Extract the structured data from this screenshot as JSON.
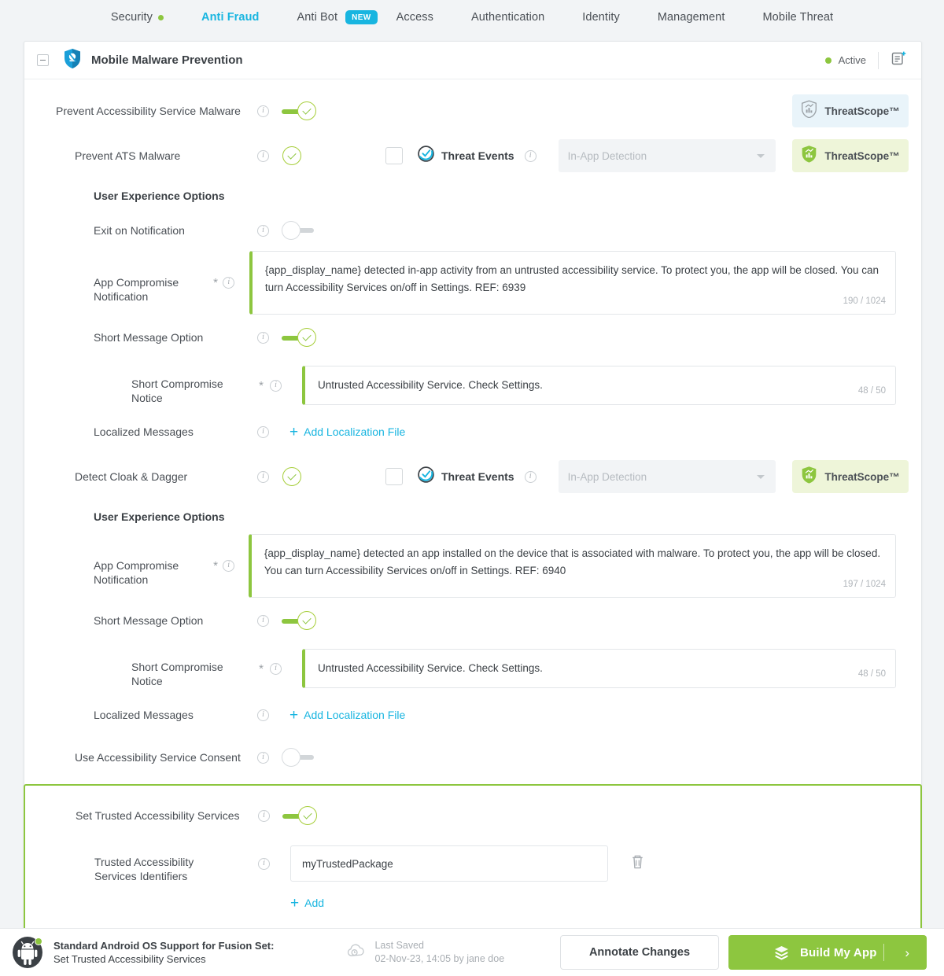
{
  "topnav": {
    "items": [
      {
        "label": "Security",
        "dot": true,
        "active": false
      },
      {
        "label": "Anti Fraud",
        "dot": false,
        "active": true
      },
      {
        "label": "Anti Bot",
        "dot": false,
        "active": false,
        "badge": "NEW"
      },
      {
        "label": "Access",
        "dot": false,
        "active": false
      },
      {
        "label": "Authentication",
        "dot": false,
        "active": false
      },
      {
        "label": "Identity",
        "dot": false,
        "active": false
      },
      {
        "label": "Management",
        "dot": false,
        "active": false
      },
      {
        "label": "Mobile Threat",
        "dot": false,
        "active": false
      }
    ]
  },
  "card": {
    "title": "Mobile Malware Prevention",
    "status": "Active",
    "icons": {
      "collapse": "collapse-minus-icon",
      "shield": "shield-malware-icon",
      "notes": "add-note-icon"
    }
  },
  "rows": {
    "prevent_accessibility": {
      "label": "Prevent Accessibility Service Malware",
      "threatscope": "ThreatScope™"
    },
    "prevent_ats": {
      "label": "Prevent ATS Malware",
      "threat_events": "Threat Events",
      "select_value": "In-App Detection",
      "threatscope": "ThreatScope™"
    },
    "uxo_1": {
      "label": "User Experience Options"
    },
    "exit_notification": {
      "label": "Exit on Notification"
    },
    "app_compromise_1": {
      "label": "App Compromise Notification",
      "value": "{app_display_name} detected in-app activity from an untrusted accessibility service. To protect you, the app will be closed. You can turn Accessibility Services on/off in Settings. REF: 6939",
      "counter": "190 / 1024"
    },
    "short_message_1": {
      "label": "Short Message Option"
    },
    "short_notice_1": {
      "label": "Short Compromise Notice",
      "value": "Untrusted Accessibility Service. Check Settings.",
      "counter": "48 / 50"
    },
    "localized_1": {
      "label": "Localized Messages",
      "link": "Add Localization File"
    },
    "detect_cloak": {
      "label": "Detect Cloak & Dagger",
      "threat_events": "Threat Events",
      "select_value": "In-App Detection",
      "threatscope": "ThreatScope™"
    },
    "uxo_2": {
      "label": "User Experience Options"
    },
    "app_compromise_2": {
      "label": "App Compromise Notification",
      "value": "{app_display_name} detected an app installed on the device that is associated with malware. To protect you, the app will be closed. You can turn Accessibility Services on/off in Settings. REF: 6940",
      "counter": "197 / 1024"
    },
    "short_message_2": {
      "label": "Short Message Option"
    },
    "short_notice_2": {
      "label": "Short Compromise Notice",
      "value": "Untrusted Accessibility Service. Check Settings.",
      "counter": "48 / 50"
    },
    "localized_2": {
      "label": "Localized Messages",
      "link": "Add Localization File"
    },
    "use_consent": {
      "label": "Use Accessibility Service Consent"
    },
    "set_trusted": {
      "label": "Set Trusted Accessibility Services"
    },
    "trusted_ids": {
      "label": "Trusted Accessibility Services Identifiers",
      "value": "myTrustedPackage",
      "add_link": "Add"
    }
  },
  "footer": {
    "fusion_title": "Standard Android OS Support for Fusion Set:",
    "fusion_sub": "Set Trusted Accessibility Services",
    "last_saved_label": "Last Saved",
    "last_saved_value": "02-Nov-23, 14:05 by jane doe",
    "annotate_label": "Annotate Changes",
    "build_label": "Build My App"
  },
  "colors": {
    "accent_green": "#8dc63f",
    "accent_blue": "#18b5e0",
    "text": "#3b4045",
    "muted": "#a9aeb3",
    "badge_blue_bg": "#e9f4fa",
    "badge_green_bg": "#eef5d9"
  }
}
